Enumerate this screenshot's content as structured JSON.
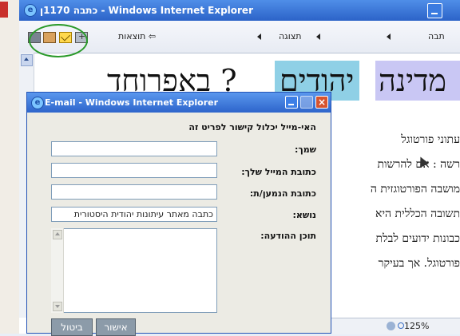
{
  "main_window": {
    "title": "כתבה 1170ן - Windows Internet Explorer",
    "toolbar": {
      "results_label": "תוצאות",
      "results_arrow": "⇦",
      "view_label": "תצוגה",
      "article_label": "תבה"
    }
  },
  "content": {
    "headline_left": "באפרוחד ?",
    "headline_mid": "יהודים",
    "headline_right": "מדינה",
    "article_lines": [
      "עתוני פורטוגל",
      "רשה : אם להרשות",
      "מושבה הפורטוגזית ה",
      "תשובה הכללית היא",
      "כבונות ידועים לבלת",
      "פורטוגל. אך בעיקר"
    ]
  },
  "statusbar": {
    "zoom": "125%"
  },
  "email_dialog": {
    "title": "E-mail - Windows Internet Explorer",
    "header": "האי-מייל יכלול קישור לפריט זה",
    "fields": {
      "name_label": "שמך:",
      "name_value": "",
      "from_label": "כתובת המייל שלך:",
      "from_value": "",
      "to_label": "כתובת הנמען/ת:",
      "to_value": "",
      "subject_label": "נושא:",
      "subject_value": "כתבה מאתר עיתונות יהודית היסטורית",
      "message_label": "תוכן ההודעה:",
      "message_value": ""
    },
    "buttons": {
      "ok": "אישור",
      "cancel": "ביטול"
    }
  }
}
